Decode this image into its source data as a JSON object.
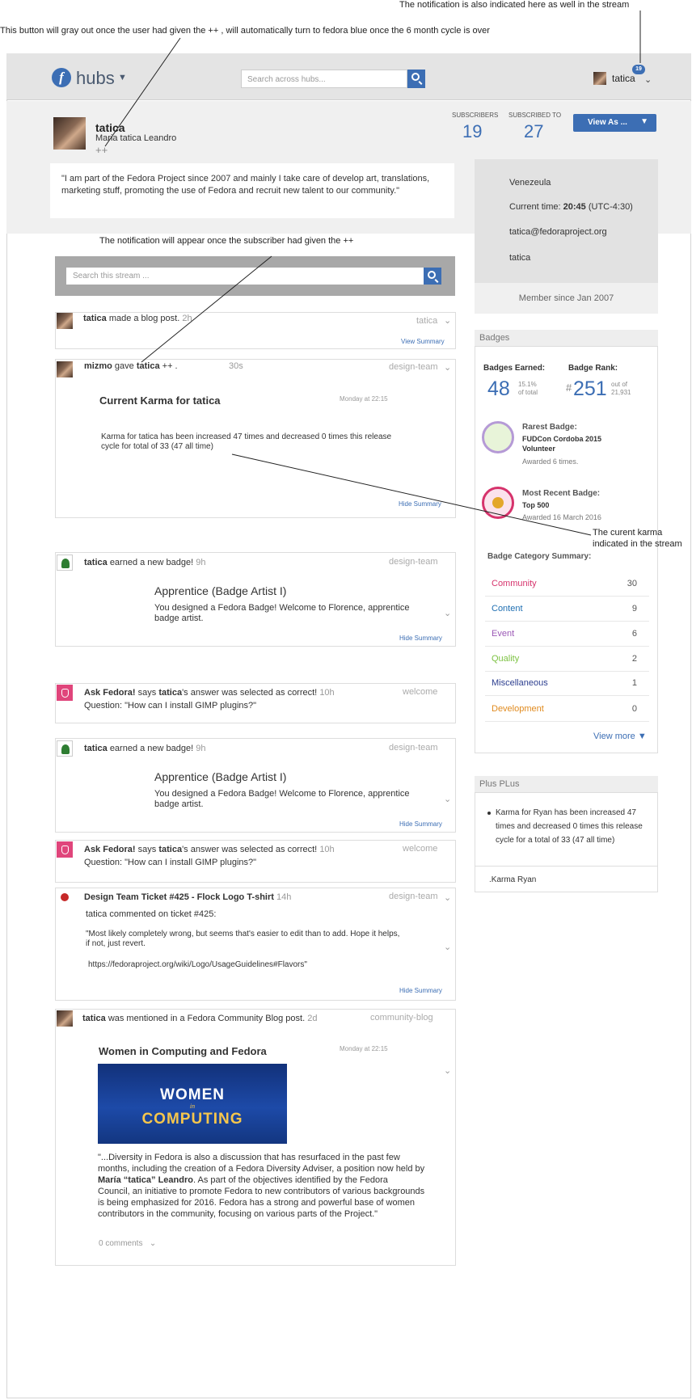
{
  "annotations": {
    "top_right": "The notification is also indicated here as well in the stream",
    "top_left": "This  button will gray out once the user had given the ++ , will automatically turn to fedora blue once the 6 month cycle is over",
    "middle": "The notification will appear once the subscriber had given the ++",
    "karma_1": "The curent karma",
    "karma_2": "indicated in the stream"
  },
  "header": {
    "logo_letter": "f",
    "app_name": "hubs",
    "search_placeholder": "Search across hubs...",
    "username": "tatica",
    "notification_count": "19"
  },
  "profile": {
    "name": "tatica",
    "full_name": "Maria tatica Leandro",
    "plus": "++",
    "bio": "\"I am part of the Fedora Project since 2007 and mainly I take care of develop art, translations, marketing stuff, promoting the use of Fedora and recruit new talent to our community.\"",
    "subscribers_label": "SUBSCRIBERS",
    "subscribers": "19",
    "subscribed_to_label": "SUBSCRIBED TO",
    "subscribed_to": "27",
    "view_as": "View As ...",
    "location": "Venezeula",
    "time_label": "Current time:",
    "time_value": "20:45",
    "time_zone": "(UTC-4:30)",
    "email": "tatica@fedoraproject.org",
    "irc": "tatica",
    "member_since": "Member since Jan 2007"
  },
  "stream": {
    "search_placeholder": "Search this stream ...",
    "blog": {
      "user": "tatica",
      "action": "made a blog post.",
      "time": "2h",
      "tag": "tatica",
      "link": "View Summary"
    },
    "karma": {
      "user": "mizmo",
      "verb": "gave",
      "target": "tatica",
      "suffix": "++ .",
      "time": "30s",
      "tag": "design-team",
      "title": "Current Karma for tatica",
      "date": "Monday at 22:15",
      "body_1": "Karma for tatica has been increased 47 times and decreased 0 times this release",
      "body_2": "cycle for total of 33 (47 all time)",
      "link": "Hide Summary"
    },
    "badge1": {
      "user": "tatica",
      "action": "earned a new badge!",
      "time": "9h",
      "tag": "design-team",
      "title": "Apprentice (Badge Artist I)",
      "body_1": "You designed a Fedora Badge! Welcome to Florence, apprentice",
      "body_2": "badge artist.",
      "link": "Hide Summary"
    },
    "ask1": {
      "source": "Ask Fedora!",
      "says": "says",
      "user": "tatica",
      "action": "'s answer was selected as correct!",
      "time": "10h",
      "tag": "welcome",
      "question": "Question: \"How can I install GIMP plugins?\""
    },
    "badge2": {
      "user": "tatica",
      "action": "earned a new badge!",
      "time": "9h",
      "tag": "design-team",
      "title": "Apprentice (Badge Artist I)",
      "body_1": "You designed a Fedora Badge! Welcome to Florence, apprentice",
      "body_2": "badge artist.",
      "link": "Hide Summary"
    },
    "ask2": {
      "source": "Ask Fedora!",
      "says": "says",
      "user": "tatica",
      "action": "'s answer was selected as correct!",
      "time": "10h",
      "tag": "welcome",
      "question": "Question: \"How can I install GIMP plugins?\""
    },
    "ticket": {
      "title": "Design Team Ticket #425 - Flock Logo T-shirt",
      "time": "14h",
      "tag": "design-team",
      "sub": "tatica commented on ticket #425:",
      "body_1": "\"Most likely completely wrong, but seems that's easier to edit than to add. Hope it helps,",
      "body_2": "if not, just revert.",
      "url": "https://fedoraproject.org/wiki/Logo/UsageGuidelines#Flavors\"",
      "link": "Hide Summary"
    },
    "mention": {
      "user": "tatica",
      "action": "was mentioned in a Fedora Community Blog post.",
      "time": "2d",
      "tag": "community-blog",
      "title": "Women in Computing and Fedora",
      "date": "Monday at 22:15",
      "img_1": "WOMEN",
      "img_2": "in",
      "img_3": "COMPUTING",
      "p1": "\"...Diversity in Fedora is also a discussion that has resurfaced in the past few",
      "p2": "months, including the creation of a Fedora Diversity Adviser, a position now held by",
      "p3a": "María “tatica” Leandro",
      "p3b": ". As part of the objectives identified by the Fedora",
      "p4": "Council, an initiative to promote Fedora to new contributors of various backgrounds",
      "p5": "is being emphasized for 2016. Fedora has a strong and powerful base of women",
      "p6": "contributors in the community, focusing on various parts of the Project.\"",
      "comments": "0 comments"
    }
  },
  "badges": {
    "header": "Badges",
    "earned_label": "Badges Earned:",
    "earned": "48",
    "earned_pct": "15.1%",
    "earned_pct_sub": "of total",
    "rank_label": "Badge Rank:",
    "rank_hash": "#",
    "rank": "251",
    "rank_out": "out of",
    "rank_total": "21,931",
    "rarest_label": "Rarest Badge:",
    "rarest_name_1": "FUDCon Cordoba 2015",
    "rarest_name_2": "Volunteer",
    "rarest_awarded": "Awarded 6 times.",
    "recent_label": "Most Recent Badge:",
    "recent_name": "Top 500",
    "recent_awarded": "Awarded 16 March 2016",
    "category_label": "Badge Category Summary:",
    "categories": [
      {
        "name": "Community",
        "count": "30",
        "color": "#d6336c"
      },
      {
        "name": "Content",
        "count": "9",
        "color": "#1f6fb2"
      },
      {
        "name": "Event",
        "count": "6",
        "color": "#9b59b6"
      },
      {
        "name": "Quality",
        "count": "2",
        "color": "#7cc242"
      },
      {
        "name": "Miscellaneous",
        "count": "1",
        "color": "#2c3e8f"
      },
      {
        "name": "Development",
        "count": "0",
        "color": "#e08a1e"
      }
    ],
    "view_more": "View more"
  },
  "plus": {
    "header": "Plus PLus",
    "item": "Karma for Ryan has been increased 47 times and decreased 0 times this release cycle for a total of 33 (47 all time)",
    "footer": ".Karma Ryan"
  },
  "colors": {
    "fedora_blue": "#3c6eb4"
  }
}
